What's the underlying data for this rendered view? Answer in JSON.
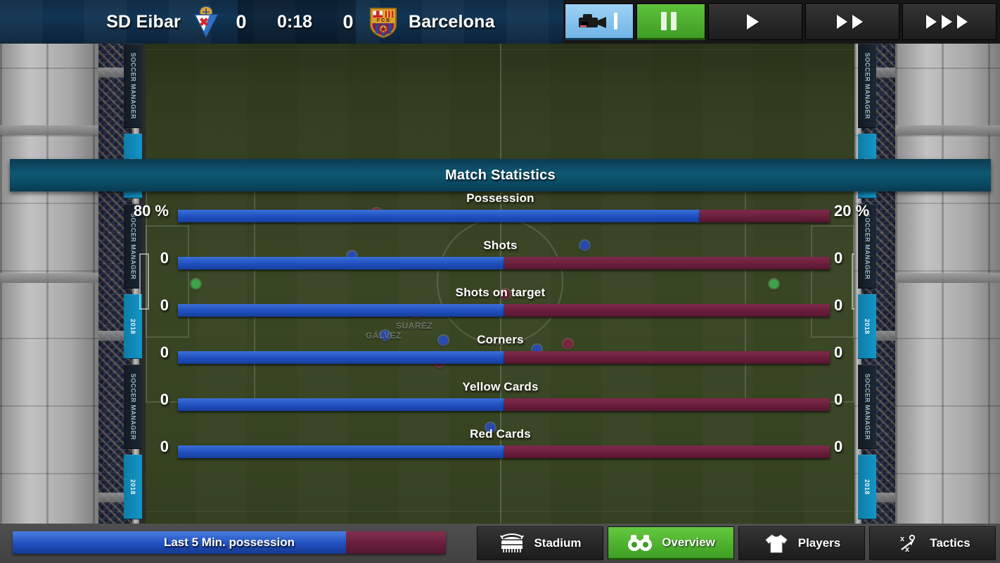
{
  "match": {
    "home_team": "SD Eibar",
    "away_team": "Barcelona",
    "home_goals": "0",
    "away_goals": "0",
    "clock": "0:18"
  },
  "controls": {
    "camera_label": "",
    "pause_label": "",
    "speed1_label": "",
    "speed2_label": "",
    "speed3_label": ""
  },
  "panel": {
    "title": "Match Statistics"
  },
  "chart_data": {
    "type": "bar",
    "title": "Match Statistics",
    "orientation": "horizontal-diverging",
    "series": [
      {
        "name": "SD Eibar",
        "color": "#1f4fbf",
        "side": "left"
      },
      {
        "name": "Barcelona",
        "color": "#6a1f3b",
        "side": "right"
      }
    ],
    "categories": [
      "Possession",
      "Shots",
      "Shots on target",
      "Corners",
      "Yellow Cards",
      "Red Cards"
    ],
    "rows": [
      {
        "label": "Possession",
        "left_value": "80 %",
        "right_value": "20 %",
        "left_pct": 80,
        "right_pct": 20
      },
      {
        "label": "Shots",
        "left_value": "0",
        "right_value": "0",
        "left_pct": 50,
        "right_pct": 50
      },
      {
        "label": "Shots on target",
        "left_value": "0",
        "right_value": "0",
        "left_pct": 50,
        "right_pct": 50
      },
      {
        "label": "Corners",
        "left_value": "0",
        "right_value": "0",
        "left_pct": 50,
        "right_pct": 50
      },
      {
        "label": "Yellow Cards",
        "left_value": "0",
        "right_value": "0",
        "left_pct": 50,
        "right_pct": 50
      },
      {
        "label": "Red Cards",
        "left_value": "0",
        "right_value": "0",
        "left_pct": 50,
        "right_pct": 50
      }
    ]
  },
  "last5": {
    "label": "Last 5 Min. possession",
    "left_pct": 77,
    "right_pct": 23
  },
  "nav": {
    "items": [
      {
        "label": "Stadium",
        "icon": "stadium-icon",
        "active": false
      },
      {
        "label": "Overview",
        "icon": "binoculars-icon",
        "active": true
      },
      {
        "label": "Players",
        "icon": "jersey-icon",
        "active": false
      },
      {
        "label": "Tactics",
        "icon": "tactics-icon",
        "active": false
      }
    ]
  },
  "pitch": {
    "player_labels": [
      "SUAREZ",
      "GÁLVEZ"
    ],
    "adboard_text_1": "SOCCER MANAGER",
    "adboard_text_2": "2018"
  },
  "colors": {
    "home": "#1f4fbf",
    "away": "#6a1f3b",
    "accent_green": "#4fae28",
    "panel_header": "#0f5873"
  }
}
